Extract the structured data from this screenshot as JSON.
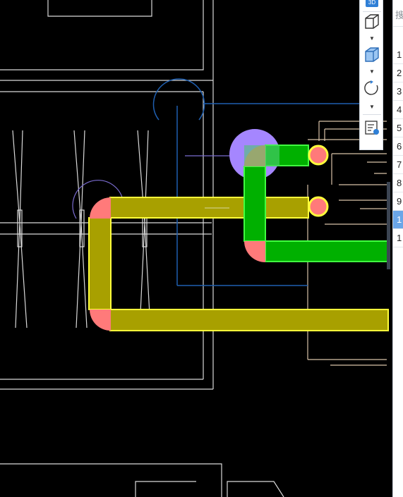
{
  "toolbar": {
    "buttons": [
      {
        "name": "3d-view-button",
        "icon": "3d-cube-icon",
        "badge": "3D"
      },
      {
        "name": "wireframe-cube-button",
        "icon": "wireframe-cube-icon"
      },
      {
        "name": "shaded-cube-button",
        "icon": "shaded-cube-icon"
      },
      {
        "name": "orbit-button",
        "icon": "rotate-icon"
      },
      {
        "name": "properties-list-button",
        "icon": "list-view-icon"
      }
    ]
  },
  "panel": {
    "search_placeholder": "搜",
    "rows": [
      "1",
      "2",
      "3",
      "4",
      "5",
      "6",
      "7",
      "8",
      "9",
      "1",
      "1"
    ],
    "selected_index": 9
  },
  "colors": {
    "background": "#000000",
    "cad_lines": "#e0e0e0",
    "beige_lines": "#d8c2a8",
    "blue_lines": "#1f5fb0",
    "yellow_duct": "#a8a000",
    "yellow_outline": "#ffff3a",
    "green_duct": "#00b000",
    "green_outline": "#40ff40",
    "elbow_pink": "#ff7a7a",
    "purple_node": "#a586ff",
    "selection_blue": "#6aa6e8"
  }
}
